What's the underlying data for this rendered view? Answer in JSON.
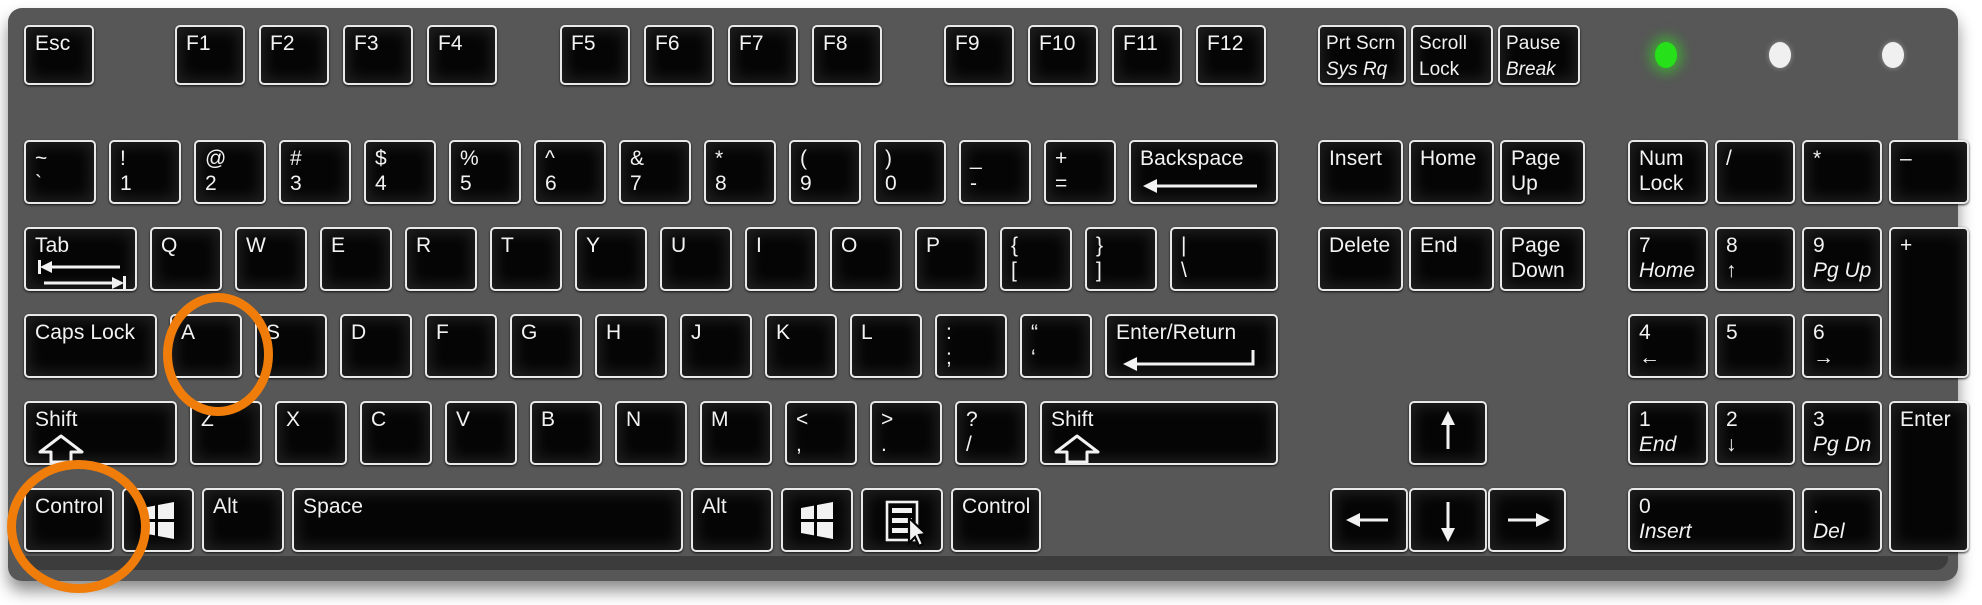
{
  "device": {
    "type": "keyboard-diagram",
    "layout": "full-size-104-key-ansi",
    "body_color": "#575757",
    "key_color": "#050505",
    "key_border_color": "#e9e9e9",
    "highlight_color": "#f07d0a"
  },
  "indicators": [
    {
      "name": "num-lock-led",
      "state": "on",
      "color": "#26e019"
    },
    {
      "name": "caps-lock-led",
      "state": "off",
      "color": "#f0f0f0"
    },
    {
      "name": "scroll-lock-led",
      "state": "off",
      "color": "#f0f0f0"
    }
  ],
  "highlights": [
    {
      "target": "key-a",
      "shape": "circle",
      "color": "#f07d0a"
    },
    {
      "target": "key-control-left",
      "shape": "circle",
      "color": "#f07d0a"
    }
  ],
  "rows": {
    "function_row": [
      {
        "id": "esc",
        "label": "Esc"
      },
      {
        "id": "f1",
        "label": "F1"
      },
      {
        "id": "f2",
        "label": "F2"
      },
      {
        "id": "f3",
        "label": "F3"
      },
      {
        "id": "f4",
        "label": "F4"
      },
      {
        "id": "f5",
        "label": "F5"
      },
      {
        "id": "f6",
        "label": "F6"
      },
      {
        "id": "f7",
        "label": "F7"
      },
      {
        "id": "f8",
        "label": "F8"
      },
      {
        "id": "f9",
        "label": "F9"
      },
      {
        "id": "f10",
        "label": "F10"
      },
      {
        "id": "f11",
        "label": "F11"
      },
      {
        "id": "f12",
        "label": "F12"
      }
    ],
    "system_keys": [
      {
        "id": "prtscrn",
        "label": "Prt Scrn",
        "label2": "Sys Rq",
        "label2_italic": true
      },
      {
        "id": "scrolllock",
        "label": "Scroll",
        "label2": "Lock",
        "label2_italic": false
      },
      {
        "id": "pause",
        "label": "Pause",
        "label2": "Break",
        "label2_italic": true
      }
    ],
    "number_row": [
      {
        "id": "backtick",
        "label": "~",
        "label2": "`"
      },
      {
        "id": "digit1",
        "label": "!",
        "label2": "1"
      },
      {
        "id": "digit2",
        "label": "@",
        "label2": "2"
      },
      {
        "id": "digit3",
        "label": "#",
        "label2": "3"
      },
      {
        "id": "digit4",
        "label": "$",
        "label2": "4"
      },
      {
        "id": "digit5",
        "label": "%",
        "label2": "5"
      },
      {
        "id": "digit6",
        "label": "^",
        "label2": "6"
      },
      {
        "id": "digit7",
        "label": "&",
        "label2": "7"
      },
      {
        "id": "digit8",
        "label": "*",
        "label2": "8"
      },
      {
        "id": "digit9",
        "label": "(",
        "label2": "9"
      },
      {
        "id": "digit0",
        "label": ")",
        "label2": "0"
      },
      {
        "id": "minus",
        "label": "_",
        "label2": "-"
      },
      {
        "id": "equal",
        "label": "+",
        "label2": "="
      },
      {
        "id": "backspace",
        "label": "Backspace",
        "label2": "",
        "icon": "backspace-arrow-icon"
      }
    ],
    "top_row": [
      {
        "id": "tab",
        "label": "Tab",
        "icon": "tab-arrows-icon"
      },
      {
        "id": "q",
        "label": "Q"
      },
      {
        "id": "w",
        "label": "W"
      },
      {
        "id": "e",
        "label": "E"
      },
      {
        "id": "r",
        "label": "R"
      },
      {
        "id": "t",
        "label": "T"
      },
      {
        "id": "y",
        "label": "Y"
      },
      {
        "id": "u",
        "label": "U"
      },
      {
        "id": "i",
        "label": "I"
      },
      {
        "id": "o",
        "label": "O"
      },
      {
        "id": "p",
        "label": "P"
      },
      {
        "id": "lbracket",
        "label": "{",
        "label2": "["
      },
      {
        "id": "rbracket",
        "label": "}",
        "label2": "]"
      },
      {
        "id": "backslash",
        "label": "|",
        "label2": "\\"
      }
    ],
    "home_row": [
      {
        "id": "capslock",
        "label": "Caps Lock"
      },
      {
        "id": "a",
        "label": "A"
      },
      {
        "id": "s",
        "label": "S"
      },
      {
        "id": "d",
        "label": "D"
      },
      {
        "id": "f",
        "label": "F"
      },
      {
        "id": "g",
        "label": "G"
      },
      {
        "id": "h",
        "label": "H"
      },
      {
        "id": "j",
        "label": "J"
      },
      {
        "id": "k",
        "label": "K"
      },
      {
        "id": "l",
        "label": "L"
      },
      {
        "id": "semicolon",
        "label": ":",
        "label2": ";"
      },
      {
        "id": "quote",
        "label": "“",
        "label2": "‘"
      },
      {
        "id": "enter",
        "label": "Enter/Return",
        "icon": "return-arrow-icon"
      }
    ],
    "bottom_letter_row": [
      {
        "id": "shift-left",
        "label": "Shift",
        "icon": "shift-up-arrow-icon"
      },
      {
        "id": "z",
        "label": "Z"
      },
      {
        "id": "x",
        "label": "X"
      },
      {
        "id": "c",
        "label": "C"
      },
      {
        "id": "v",
        "label": "V"
      },
      {
        "id": "b",
        "label": "B"
      },
      {
        "id": "n",
        "label": "N"
      },
      {
        "id": "m",
        "label": "M"
      },
      {
        "id": "comma",
        "label": "<",
        "label2": ","
      },
      {
        "id": "period",
        "label": ">",
        "label2": "."
      },
      {
        "id": "slash",
        "label": "?",
        "label2": "/"
      },
      {
        "id": "shift-right",
        "label": "Shift",
        "icon": "shift-up-arrow-icon"
      }
    ],
    "modifier_row": [
      {
        "id": "control-left",
        "label": "Control"
      },
      {
        "id": "win-left",
        "label": "",
        "icon": "windows-logo-icon"
      },
      {
        "id": "alt-left",
        "label": "Alt"
      },
      {
        "id": "space",
        "label": "Space"
      },
      {
        "id": "alt-right",
        "label": "Alt"
      },
      {
        "id": "win-right",
        "label": "",
        "icon": "windows-logo-icon"
      },
      {
        "id": "menu",
        "label": "",
        "icon": "context-menu-icon"
      },
      {
        "id": "control-right",
        "label": "Control"
      }
    ]
  },
  "navigation_cluster": [
    {
      "id": "insert",
      "label": "Insert"
    },
    {
      "id": "home",
      "label": "Home"
    },
    {
      "id": "pageup",
      "label": "Page",
      "label2": "Up"
    },
    {
      "id": "delete",
      "label": "Delete"
    },
    {
      "id": "end",
      "label": "End"
    },
    {
      "id": "pagedown",
      "label": "Page",
      "label2": "Down"
    }
  ],
  "arrow_cluster": [
    {
      "id": "arrow-up",
      "icon": "arrow-up-icon",
      "glyph": "↑"
    },
    {
      "id": "arrow-left",
      "icon": "arrow-left-icon",
      "glyph": "←"
    },
    {
      "id": "arrow-down",
      "icon": "arrow-down-icon",
      "glyph": "↓"
    },
    {
      "id": "arrow-right",
      "icon": "arrow-right-icon",
      "glyph": "→"
    }
  ],
  "numpad": [
    {
      "id": "numlock",
      "label": "Num",
      "label2": "Lock"
    },
    {
      "id": "num-div",
      "label": "/"
    },
    {
      "id": "num-mul",
      "label": "*"
    },
    {
      "id": "num-sub",
      "label": "–"
    },
    {
      "id": "num7",
      "label": "7",
      "label2": "Home",
      "label2_italic": true
    },
    {
      "id": "num8",
      "label": "8",
      "label2": "↑"
    },
    {
      "id": "num9",
      "label": "9",
      "label2": "Pg Up",
      "label2_italic": true
    },
    {
      "id": "num-add",
      "label": "+"
    },
    {
      "id": "num4",
      "label": "4",
      "label2": "←"
    },
    {
      "id": "num5",
      "label": "5"
    },
    {
      "id": "num6",
      "label": "6",
      "label2": "→"
    },
    {
      "id": "num1",
      "label": "1",
      "label2": "End",
      "label2_italic": true
    },
    {
      "id": "num2",
      "label": "2",
      "label2": "↓"
    },
    {
      "id": "num3",
      "label": "3",
      "label2": "Pg Dn",
      "label2_italic": true
    },
    {
      "id": "num-enter",
      "label": "Enter"
    },
    {
      "id": "num0",
      "label": "0",
      "label2": "Insert",
      "label2_italic": true
    },
    {
      "id": "num-dot",
      "label": ".",
      "label2": "Del",
      "label2_italic": true
    }
  ]
}
